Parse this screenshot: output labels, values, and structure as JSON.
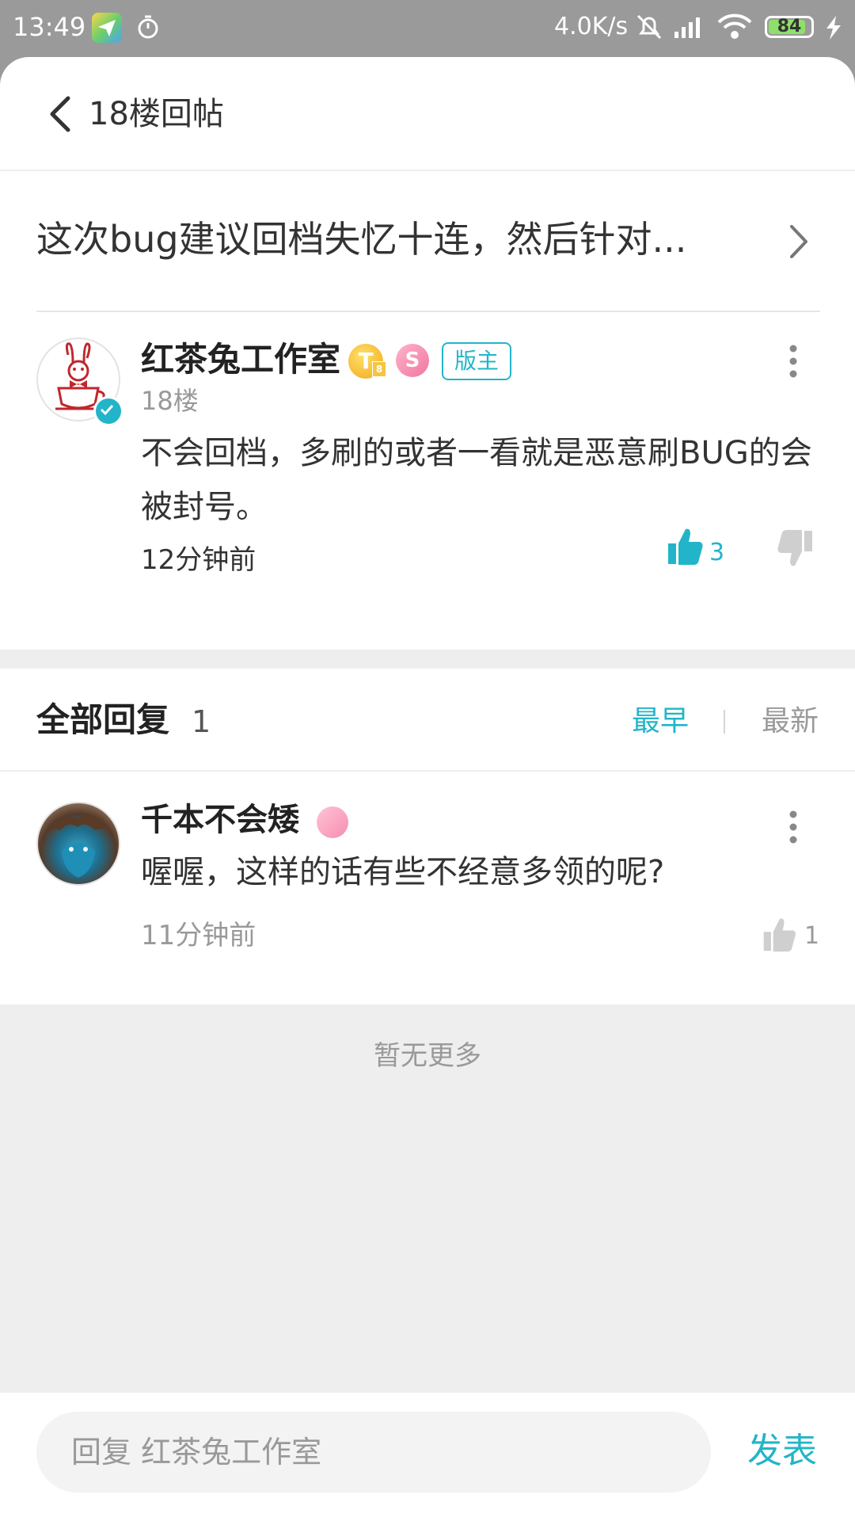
{
  "status_bar": {
    "time": "13:49",
    "net_speed": "4.0K/s",
    "battery": "84"
  },
  "header": {
    "title": "18楼回帖"
  },
  "topic": {
    "title": "这次bug建议回档失忆十连，然后针对..."
  },
  "post": {
    "author": "红茶兔工作室",
    "level_badge": "T",
    "level_sub": "8",
    "role_badge": "版主",
    "floor": "18楼",
    "content": "不会回档，多刷的或者一看就是恶意刷BUG的会被封号。",
    "time": "12分钟前",
    "likes": "3"
  },
  "replies_header": {
    "title": "全部回复",
    "count": "1",
    "sort_earliest": "最早",
    "sort_newest": "最新"
  },
  "replies": [
    {
      "author": "千本不会矮",
      "content": "喔喔，这样的话有些不经意多领的呢?",
      "time": "11分钟前",
      "likes": "1"
    }
  ],
  "footer": {
    "no_more": "暂无更多"
  },
  "reply_bar": {
    "placeholder": "回复 红茶兔工作室",
    "send_label": "发表"
  },
  "colors": {
    "accent": "#22b5c9",
    "mod_badge": "#22b5c9"
  },
  "icons": [
    "back-icon",
    "chevron-right-icon",
    "more-vertical-icon",
    "thumbs-up-icon",
    "thumbs-down-icon",
    "verified-icon"
  ]
}
